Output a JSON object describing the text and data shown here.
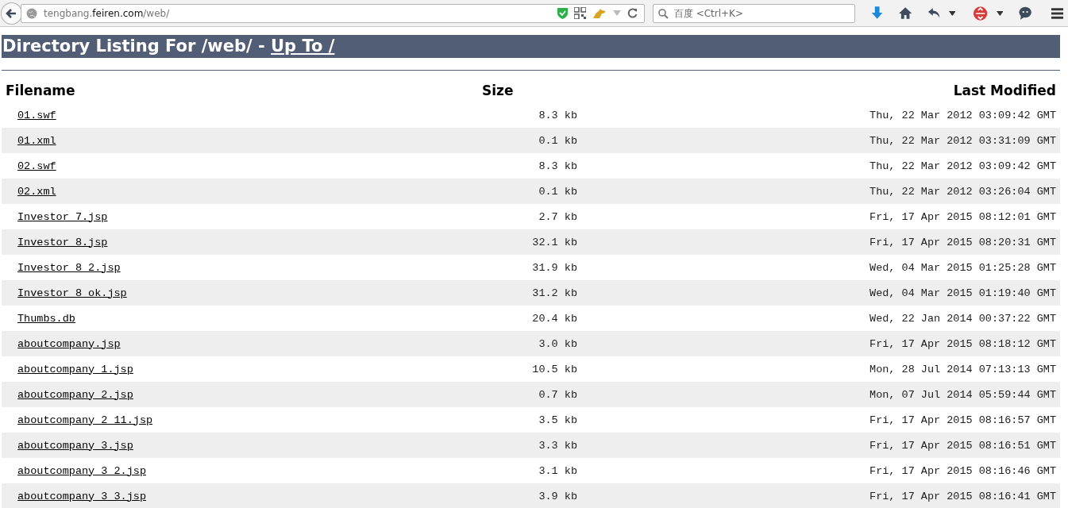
{
  "browser": {
    "url_host_prefix": "tengbang.",
    "url_host_domain": "feiren.com",
    "url_path": "/web/",
    "search_placeholder": "百度 <Ctrl+K>"
  },
  "page": {
    "title": "Directory Listing For /web/ - ",
    "up_link": "Up To /",
    "columns": [
      "Filename",
      "Size",
      "Last Modified"
    ],
    "rows": [
      {
        "name": "01.swf",
        "size": "8.3 kb",
        "modified": "Thu, 22 Mar 2012 03:09:42 GMT"
      },
      {
        "name": "01.xml",
        "size": "0.1 kb",
        "modified": "Thu, 22 Mar 2012 03:31:09 GMT"
      },
      {
        "name": "02.swf",
        "size": "8.3 kb",
        "modified": "Thu, 22 Mar 2012 03:09:42 GMT"
      },
      {
        "name": "02.xml",
        "size": "0.1 kb",
        "modified": "Thu, 22 Mar 2012 03:26:04 GMT"
      },
      {
        "name": "Investor_7.jsp",
        "size": "2.7 kb",
        "modified": "Fri, 17 Apr 2015 08:12:01 GMT"
      },
      {
        "name": "Investor_8.jsp",
        "size": "32.1 kb",
        "modified": "Fri, 17 Apr 2015 08:20:31 GMT"
      },
      {
        "name": "Investor_8_2.jsp",
        "size": "31.9 kb",
        "modified": "Wed, 04 Mar 2015 01:25:28 GMT"
      },
      {
        "name": "Investor_8_ok.jsp",
        "size": "31.2 kb",
        "modified": "Wed, 04 Mar 2015 01:19:40 GMT"
      },
      {
        "name": "Thumbs.db",
        "size": "20.4 kb",
        "modified": "Wed, 22 Jan 2014 00:37:22 GMT"
      },
      {
        "name": "aboutcompany.jsp",
        "size": "3.0 kb",
        "modified": "Fri, 17 Apr 2015 08:18:12 GMT"
      },
      {
        "name": "aboutcompany_1.jsp",
        "size": "10.5 kb",
        "modified": "Mon, 28 Jul 2014 07:13:13 GMT"
      },
      {
        "name": "aboutcompany_2.jsp",
        "size": "0.7 kb",
        "modified": "Mon, 07 Jul 2014 05:59:44 GMT"
      },
      {
        "name": "aboutcompany_2_11.jsp",
        "size": "3.5 kb",
        "modified": "Fri, 17 Apr 2015 08:16:57 GMT"
      },
      {
        "name": "aboutcompany_3.jsp",
        "size": "3.3 kb",
        "modified": "Fri, 17 Apr 2015 08:16:51 GMT"
      },
      {
        "name": "aboutcompany_3_2.jsp",
        "size": "3.1 kb",
        "modified": "Fri, 17 Apr 2015 08:16:46 GMT"
      },
      {
        "name": "aboutcompany_3_3.jsp",
        "size": "3.9 kb",
        "modified": "Fri, 17 Apr 2015 08:16:41 GMT"
      }
    ]
  }
}
